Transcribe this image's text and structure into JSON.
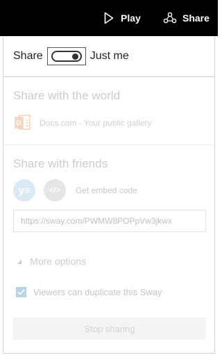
{
  "topbar": {
    "play_label": "Play",
    "share_label": "Share",
    "play_icon": "play-triangle-icon",
    "share_icon": "share-nodes-icon",
    "background": "#000000"
  },
  "share_row": {
    "prefix": "Share",
    "toggle_state": "off",
    "suffix": "Just me"
  },
  "world": {
    "title": "Share with the world",
    "docs_icon": "docs-com-icon",
    "docs_label": "Docs.com - Your public gallery"
  },
  "friends": {
    "title": "Share with friends",
    "yammer_glyph": "y≡",
    "embed_glyph": "</>",
    "embed_label": "Get embed code",
    "url_value": "https://sway.com/PWMW8POPpVw3jkwx"
  },
  "more_options": {
    "label": "More options"
  },
  "duplicate": {
    "checked": true,
    "label": "Viewers can duplicate this Sway"
  },
  "stop_sharing": {
    "label": "Stop sharing"
  },
  "colors": {
    "accent_faded": "#b6d4ea",
    "docs_orange": "#f2d2bf"
  }
}
